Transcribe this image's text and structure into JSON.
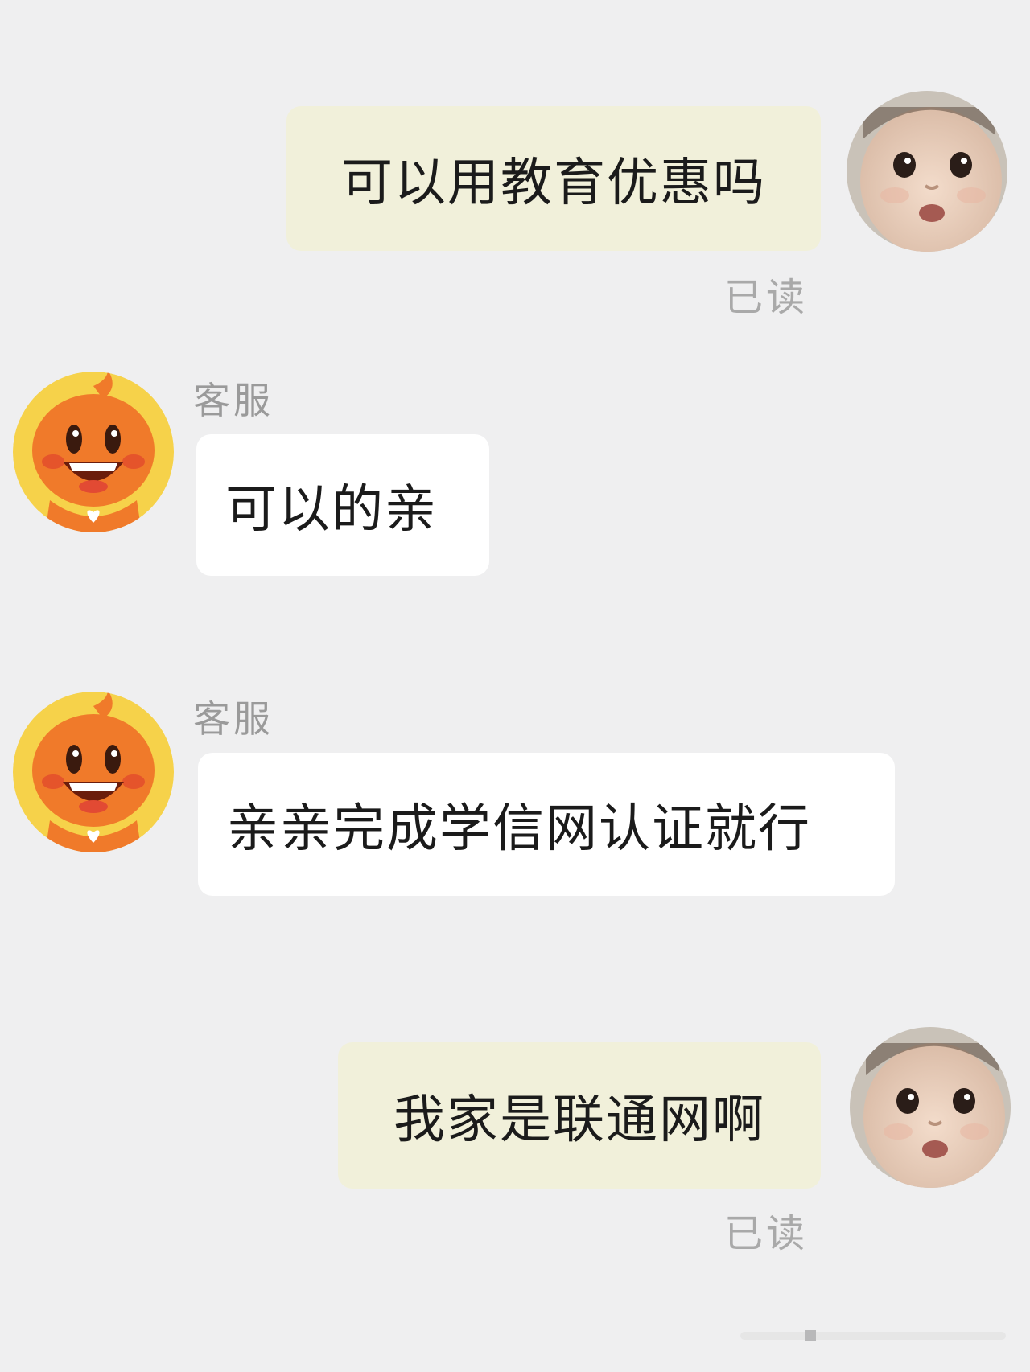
{
  "messages": [
    {
      "role": "user",
      "text": "可以用教育优惠吗",
      "status": "已读"
    },
    {
      "role": "agent",
      "sender": "客服",
      "text": "可以的亲"
    },
    {
      "role": "agent",
      "sender": "客服",
      "text": "亲亲完成学信网认证就行"
    },
    {
      "role": "user",
      "text": "我家是联通网啊",
      "status": "已读"
    }
  ],
  "avatars": {
    "user": "baby-face-avatar",
    "agent": "orange-mascot-avatar"
  },
  "colors": {
    "background": "#efeff0",
    "user_bubble": "#f1f0da",
    "agent_bubble": "#ffffff",
    "mascot_orange": "#f07a2a",
    "mascot_ring": "#f6d24a"
  }
}
